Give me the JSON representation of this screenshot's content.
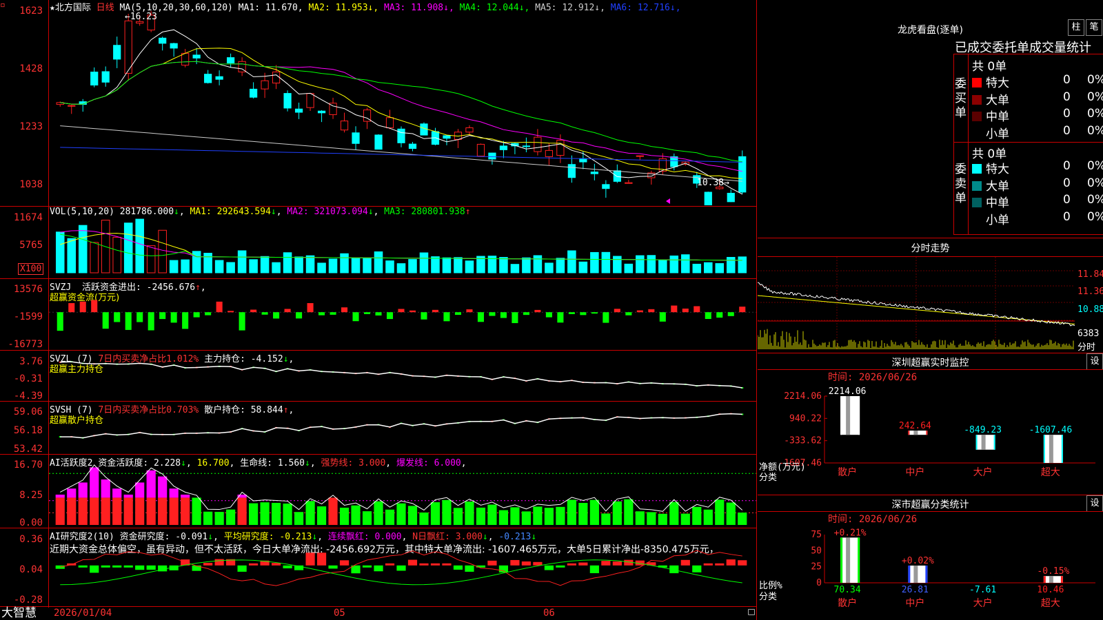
{
  "colors": {
    "up": "#ff2020",
    "down": "#00ffff",
    "green": "#00ff00",
    "magenta": "#ff00ff",
    "yellow": "#ffff00",
    "grid": "#c00000",
    "white": "#ffffff",
    "gray": "#888888",
    "blue": "#2040ff"
  },
  "main": {
    "title_star": "★",
    "stock_name": "北方国际",
    "period": "日线",
    "ma_header": "MA(5,10,20,30,60,120)",
    "ma": [
      {
        "label": "MA1: 11.670",
        "color": "#ffffff"
      },
      {
        "label": "MA2: 11.953",
        "color": "#ffff00"
      },
      {
        "label": "MA3: 11.908",
        "color": "#ff00ff"
      },
      {
        "label": "MA4: 12.044",
        "color": "#00ff00"
      },
      {
        "label": "MA5: 12.912",
        "color": "#cccccc"
      },
      {
        "label": "MA6: 12.716",
        "color": "#2040ff"
      }
    ],
    "high_label": "16.23",
    "low_label": "10.38",
    "y_ticks": [
      "1623",
      "1428",
      "1233",
      "1038"
    ],
    "menu_icon": "grid-menu-icon"
  },
  "vol": {
    "header": "VOL(5,10,20)",
    "value": "281786.000",
    "ma1": "MA1: 292643.594",
    "ma2": "MA2: 321073.094",
    "ma3": "MA3: 280801.938",
    "y_ticks": [
      "11674",
      "5765"
    ],
    "unit": "X100"
  },
  "svzj": {
    "name": "SVZJ",
    "desc": "活跃资金进出: -2456.676",
    "sub": "超赢资金流(万元)",
    "y_ticks": [
      "13576",
      "-1599",
      "-16773"
    ]
  },
  "svzl": {
    "name": "SVZL (7)",
    "desc": "7日内买卖净占比1.012%",
    "hold": "主力持仓: -4.152",
    "sub": "超赢主力持仓",
    "y_ticks": [
      "3.76",
      "-0.31",
      "-4.39"
    ]
  },
  "svsh": {
    "name": "SVSH (7)",
    "desc": "7日内买卖净占比0.703%",
    "hold": "散户持仓: 58.844",
    "sub": "超赢散户持仓",
    "y_ticks": [
      "59.06",
      "56.18",
      "53.42"
    ]
  },
  "ai1": {
    "name": "AI活跃度2",
    "a": "资金活跃度: 2.228",
    "b": "16.700",
    "c": "生命线: 1.560",
    "d": "强势线: 3.000",
    "e": "爆发线: 6.000",
    "y_ticks": [
      "16.70",
      "8.25",
      "0.00"
    ]
  },
  "ai2": {
    "name": "AI研究度2(10)",
    "a": "资金研究度: -0.091",
    "b": "平均研究度: -0.213",
    "c": "连续飘红: 0.000",
    "d": "N日飘红: 3.000",
    "e": "-0.213",
    "comment": "近期大资金总体偏空，虽有异动，但不太活跃，今日大单净流出: -2456.692万元，其中特大单净流出: -1607.465万元，大单5日累计净出-8350.475万元，",
    "y_ticks": [
      "0.36",
      "0.04",
      "-0.28"
    ]
  },
  "footer": {
    "brand": "大智慧",
    "dates": [
      "2026/01/04",
      "05",
      "06"
    ],
    "lock_icon": "lock-icon"
  },
  "lhb": {
    "title": "龙虎看盘(逐单)",
    "btn1": "柱",
    "btn2": "笔",
    "subtitle": "已成交委托单成交量统计",
    "buy_side": "委买单",
    "sell_side": "委卖单",
    "buy_total": "共 0单",
    "sell_total": "共 0单",
    "buy_rows": [
      {
        "name": "特大",
        "v": "0",
        "p": "0%",
        "color": "#ff0000"
      },
      {
        "name": "大单",
        "v": "0",
        "p": "0%",
        "color": "#8b0000"
      },
      {
        "name": "中单",
        "v": "0",
        "p": "0%",
        "color": "#5a0000"
      },
      {
        "name": "小单",
        "v": "0",
        "p": "0%",
        "color": "#000000"
      }
    ],
    "sell_rows": [
      {
        "name": "特大",
        "v": "0",
        "p": "0%",
        "color": "#00ffff"
      },
      {
        "name": "大单",
        "v": "0",
        "p": "0%",
        "color": "#008b8b"
      },
      {
        "name": "中单",
        "v": "0",
        "p": "0%",
        "color": "#006060"
      },
      {
        "name": "小单",
        "v": "0",
        "p": "0%",
        "color": "#000000"
      }
    ]
  },
  "fenshi": {
    "title": "分时走势",
    "prices": [
      "11.84",
      "11.36",
      "10.88"
    ],
    "vol_label": "6383",
    "vol_unit": "分时"
  },
  "monitor": {
    "title": "深圳超赢实时监控",
    "btn": "设",
    "time": "时间: 2026/06/26",
    "y_ticks": [
      "2214.06",
      "940.22",
      "-333.62",
      "-1607.46"
    ],
    "unit_label": "净额(万元)",
    "cat_label": "分类",
    "bars": [
      {
        "cat": "散户",
        "value": 2214.06,
        "label": "2214.06"
      },
      {
        "cat": "中户",
        "value": 242.64,
        "label": "242.64"
      },
      {
        "cat": "大户",
        "value": -849.23,
        "label": "-849.23"
      },
      {
        "cat": "超大",
        "value": -1607.46,
        "label": "-1607.46"
      }
    ]
  },
  "classify": {
    "title": "深市超赢分类统计",
    "btn": "设",
    "time": "时间: 2026/06/26",
    "y_ticks": [
      "75",
      "50",
      "25",
      "0"
    ],
    "unit_label": "比例%",
    "cat_label": "分类",
    "bars": [
      {
        "cat": "散户",
        "value": 70.34,
        "label": "70.34",
        "top": "+0.21%"
      },
      {
        "cat": "中户",
        "value": 26.81,
        "label": "26.81",
        "top": "+0.02%"
      },
      {
        "cat": "大户",
        "value": -7.61,
        "label": "-7.61",
        "top": ""
      },
      {
        "cat": "超大",
        "value": 10.46,
        "label": "10.46",
        "top": "-0.15%"
      }
    ]
  }
}
